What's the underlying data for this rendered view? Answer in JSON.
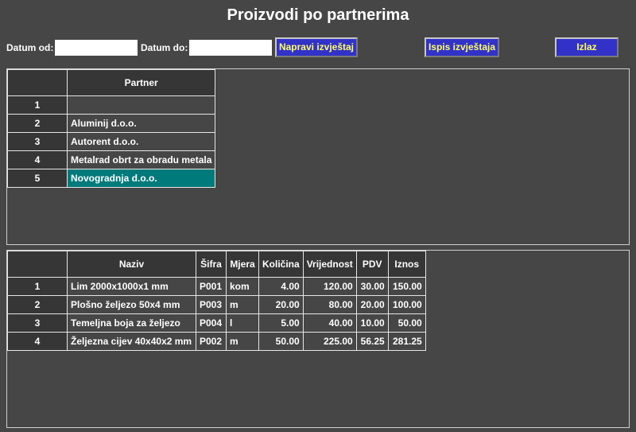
{
  "window": {
    "title": "Proizvodi po partnerima"
  },
  "filters": {
    "date_from_label": "Datum od:",
    "date_from_value": "",
    "date_to_label": "Datum do:",
    "date_to_value": ""
  },
  "toolbar": {
    "make_report_label": "Napravi izvještaj",
    "print_report_label": "Ispis izvještaja",
    "exit_label": "Izlaz"
  },
  "partners": {
    "column_header": "Partner",
    "rows": [
      {
        "num": "1",
        "name": ""
      },
      {
        "num": "2",
        "name": "Aluminij d.o.o."
      },
      {
        "num": "3",
        "name": "Autorent d.o.o."
      },
      {
        "num": "4",
        "name": "Metalrad obrt za obradu metala"
      },
      {
        "num": "5",
        "name": "Novogradnja d.o.o.",
        "selected": true
      }
    ]
  },
  "products": {
    "columns": [
      "Naziv",
      "Šifra",
      "Mjera",
      "Količina",
      "Vrijednost",
      "PDV",
      "Iznos"
    ],
    "rows": [
      {
        "num": "1",
        "naziv": "Lim 2000x1000x1 mm",
        "sifra": "P001",
        "mjera": "kom",
        "kolicina": "4.00",
        "vrijednost": "120.00",
        "pdv": "30.00",
        "iznos": "150.00"
      },
      {
        "num": "2",
        "naziv": "Plošno željezo 50x4 mm",
        "sifra": "P003",
        "mjera": "m",
        "kolicina": "20.00",
        "vrijednost": "80.00",
        "pdv": "20.00",
        "iznos": "100.00"
      },
      {
        "num": "3",
        "naziv": "Temeljna boja za željezo",
        "sifra": "P004",
        "mjera": "l",
        "kolicina": "5.00",
        "vrijednost": "40.00",
        "pdv": "10.00",
        "iznos": "50.00"
      },
      {
        "num": "4",
        "naziv": "Željezna cijev 40x40x2 mm",
        "sifra": "P002",
        "mjera": "m",
        "kolicina": "50.00",
        "vrijednost": "225.00",
        "pdv": "56.25",
        "iznos": "281.25"
      }
    ]
  },
  "colors": {
    "background": "#464646",
    "header_cell": "#363636",
    "selection": "#007a7a",
    "button_bg": "#3232c8",
    "button_text": "#ffff66"
  }
}
